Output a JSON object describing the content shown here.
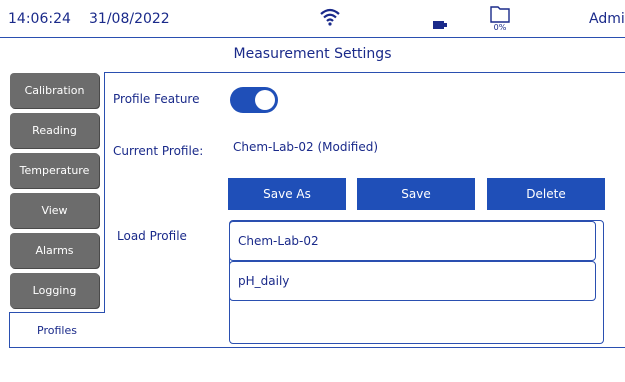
{
  "status": {
    "time": "14:06:24",
    "date": "31/08/2022",
    "storage_pct": "0%",
    "user": "Admin",
    "wifi_icon": "wifi-icon",
    "battery_icon": "battery-icon",
    "storage_icon": "storage-icon"
  },
  "page": {
    "title": "Measurement Settings"
  },
  "tabs": [
    {
      "label": "Calibration"
    },
    {
      "label": "Reading"
    },
    {
      "label": "Temperature"
    },
    {
      "label": "View"
    },
    {
      "label": "Alarms"
    },
    {
      "label": "Logging"
    },
    {
      "label": "Profiles",
      "active": true
    }
  ],
  "profile": {
    "feature_label": "Profile Feature",
    "feature_enabled": true,
    "current_label": "Current Profile:",
    "current_value": "Chem-Lab-02 (Modified)",
    "buttons": {
      "save_as": "Save As",
      "save": "Save",
      "delete": "Delete"
    },
    "load_label": "Load Profile",
    "profiles": [
      "Chem-Lab-02",
      "pH_daily"
    ]
  },
  "colors": {
    "accent": "#1f4fb8",
    "tab_bg": "#6c6c6c",
    "text": "#1a2a8a"
  }
}
